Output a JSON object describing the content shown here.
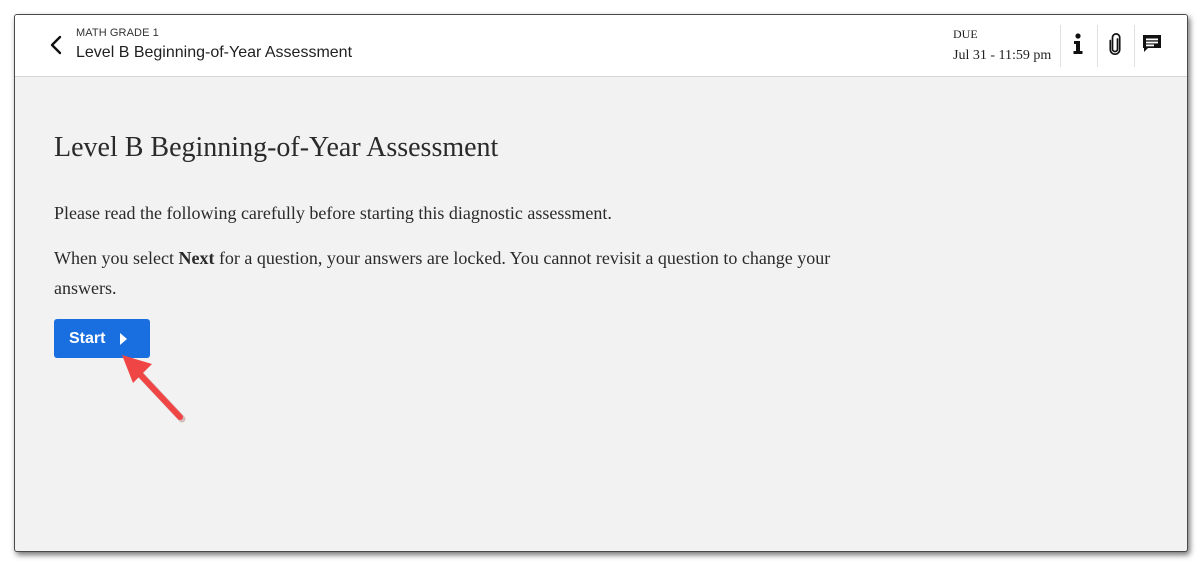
{
  "header": {
    "back_icon": "chevron-left-icon",
    "course": "MATH GRADE 1",
    "title": "Level B Beginning-of-Year Assessment",
    "due_label": "DUE",
    "due_value": "Jul 31 - 11:59 pm",
    "actions": [
      {
        "icon": "info-icon"
      },
      {
        "icon": "paperclip-icon"
      },
      {
        "icon": "comment-icon"
      }
    ]
  },
  "main": {
    "title": "Level B Beginning-of-Year Assessment",
    "instruction": "Please read the following carefully before starting this diagnostic assessment.",
    "warning_prefix": "When you select ",
    "warning_bold": "Next",
    "warning_suffix": " for a question, your answers are locked. You cannot revisit a question to change your answers.",
    "start_label": "Start",
    "start_icon": "caret-right-icon"
  },
  "annotation": {
    "icon": "red-arrow-pointer",
    "color": "#f04545"
  },
  "colors": {
    "accent": "#1a6fe0",
    "page_bg": "#f2f2f2",
    "header_bg": "#ffffff"
  }
}
